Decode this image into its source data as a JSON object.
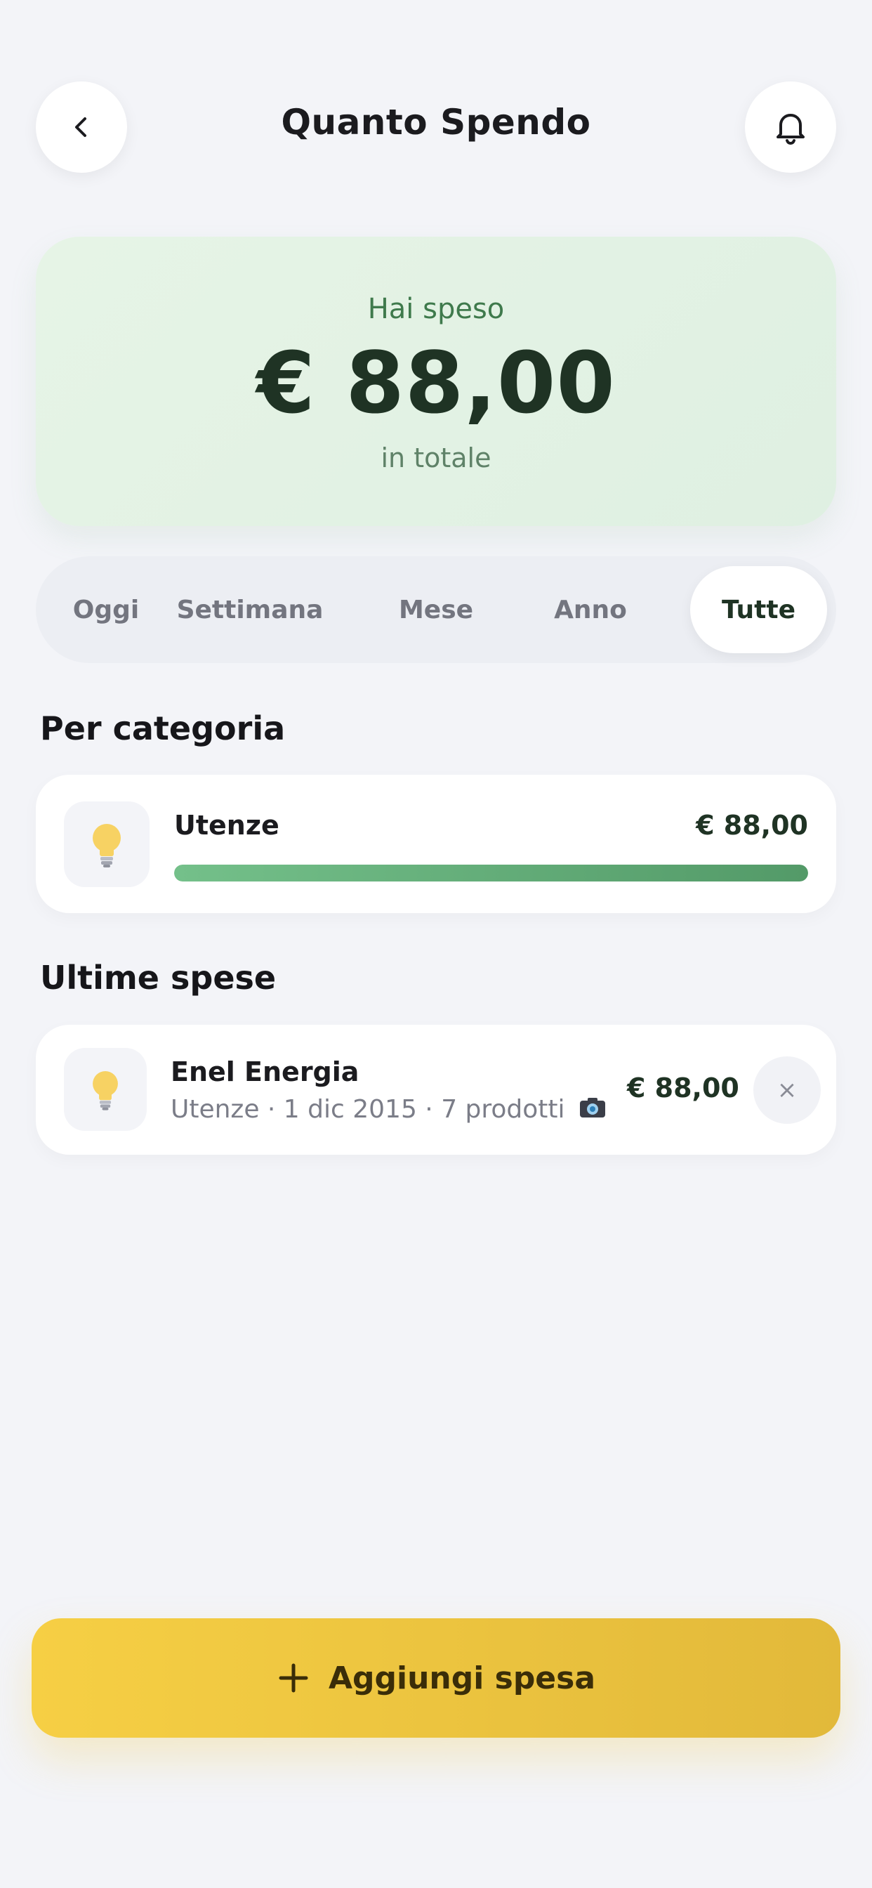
{
  "header": {
    "title": "Quanto Spendo",
    "back_icon": "chevron-left-icon",
    "bell_icon": "bell-icon"
  },
  "summary": {
    "label": "Hai speso",
    "amount": "€ 88,00",
    "sub": "in totale"
  },
  "filters": {
    "items": [
      {
        "label": "Oggi"
      },
      {
        "label": "Settimana"
      },
      {
        "label": "Mese"
      },
      {
        "label": "Anno"
      },
      {
        "label": "Tutte"
      }
    ],
    "active": "Tutte"
  },
  "categories": {
    "title": "Per categoria",
    "items": [
      {
        "name": "Utenze",
        "amount": "€ 88,00",
        "share": 1.0,
        "icon": "lightbulb-icon"
      }
    ]
  },
  "recent": {
    "title": "Ultime spese",
    "items": [
      {
        "name": "Enel Energia",
        "meta": "Utenze · 1 dic 2015 · 7 prodotti",
        "amount": "€ 88,00",
        "icon": "lightbulb-icon",
        "camera_icon": "camera-icon",
        "delete_glyph": "×"
      }
    ]
  },
  "actions": {
    "add_label": "Aggiungi spesa",
    "add_icon": "plus-icon"
  },
  "colors": {
    "accent_yellow": "#f2c843",
    "accent_green": "#5aa872",
    "background": "#f3f4f8"
  }
}
